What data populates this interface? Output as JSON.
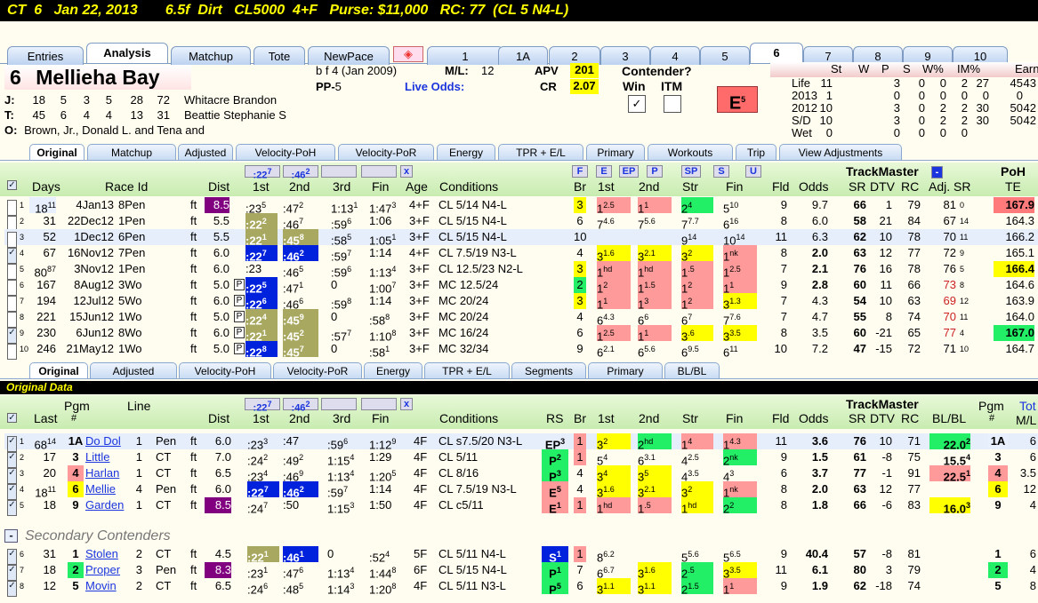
{
  "title": "CT  6   Jan 22, 2013       6.5f  Dirt   CL5000  4+F   Purse: $11,000   RC: 77  (CL 5 N4-L)",
  "main_tabs": [
    "Entries",
    "Analysis",
    "Matchup",
    "Tote",
    "NewPace"
  ],
  "horse_tabs": [
    "1",
    "1A",
    "2",
    "3",
    "4",
    "5",
    "6",
    "7",
    "8",
    "9",
    "10"
  ],
  "horse": {
    "num": "6",
    "name": "Mellieha Bay",
    "desc": "b f 4  (Jan 2009)",
    "pp_label": "PP-",
    "pp": "5",
    "ml_label": "M/L:",
    "ml": "12",
    "live_odds": "Live Odds:",
    "apv_label": "APV",
    "apv": "201",
    "cr_label": "CR",
    "cr": "2.07",
    "contender": "Contender?",
    "win": "Win",
    "itm": "ITM",
    "e_badge": "E",
    "e_sub": "5"
  },
  "jt": {
    "j_label": "J:",
    "j": [
      "18",
      "5",
      "3",
      "5",
      "28",
      "72"
    ],
    "j_name": "Whitacre Brandon",
    "t_label": "T:",
    "t": [
      "45",
      "6",
      "4",
      "4",
      "13",
      "31"
    ],
    "t_name": "Beattie Stephanie S",
    "o_label": "O:",
    "owner": "Brown, Jr., Donald L. and Tena and"
  },
  "stats": {
    "headers": [
      "St",
      "W",
      "P",
      "S",
      "W%",
      "IM%",
      "Earn"
    ],
    "rows": [
      [
        "Life",
        "11",
        "3",
        "0",
        "0",
        "2",
        "27",
        "45",
        "43"
      ],
      [
        "2013",
        "1",
        "0",
        "0",
        "0",
        "0",
        "0",
        "0",
        ""
      ],
      [
        "2012",
        "10",
        "3",
        "0",
        "2",
        "2",
        "30",
        "50",
        "42"
      ],
      [
        "S/D",
        "10",
        "3",
        "0",
        "2",
        "2",
        "30",
        "50",
        "42"
      ],
      [
        "Wet",
        "0",
        "0",
        "0",
        "0",
        "0",
        "",
        "",
        ""
      ]
    ]
  },
  "sub_tabs": [
    "Original",
    "Matchup",
    "Adjusted",
    "Velocity-PoH",
    "Velocity-PoR",
    "Energy",
    "TPR + E/L",
    "Primary",
    "Workouts",
    "Trip",
    "View Adjustments"
  ],
  "pp_headers": {
    "days": "Days",
    "raceid": "Race Id",
    "dist": "Dist",
    "c1": "1st",
    "c2": "2nd",
    "c3": "3rd",
    "fin": "Fin",
    "age": "Age",
    "cond": "Conditions",
    "br": "Br",
    "f1": "1st",
    "f2": "2nd",
    "str": "Str",
    "ffin": "Fin",
    "fld": "Fld",
    "odds": "Odds",
    "tm": "TrackMaster",
    "sr": "SR",
    "dtv": "DTV",
    "rc": "RC",
    "adj": "Adj. SR",
    "poh": "PoH",
    "te": "TE",
    "b1": ":22",
    "b1s": "7",
    "b2": ":46",
    "b2s": "2",
    "pbtns": [
      "F",
      "E",
      "EP",
      "P",
      "SP",
      "S",
      "U"
    ]
  },
  "pp_rows": [
    [
      "1",
      "18",
      "11",
      "4Jan13",
      "8Pen",
      "ft",
      "8.5",
      ":23",
      "5",
      ":47",
      "2",
      "1:13",
      "1",
      "1:47",
      "3",
      "4+F",
      "CL 5/14 N4-L",
      "3",
      "1",
      "2.5",
      "1",
      "1",
      "2",
      "4",
      "5",
      "10",
      "9",
      "9.7",
      "66",
      "1",
      "79",
      "81",
      "0",
      "167.9"
    ],
    [
      "2",
      "31",
      "",
      "22Dec12",
      "1Pen",
      "ft",
      "5.5",
      ":22",
      "2",
      ":46",
      "7",
      ":59",
      "6",
      "1:06",
      "",
      "3+F",
      "CL 5/15 N4-L",
      "6",
      "7",
      "4.6",
      "7",
      "5.6",
      "7",
      "7.7",
      "6",
      "16",
      "8",
      "6.0",
      "58",
      "21",
      "84",
      "67",
      "14",
      "164.3"
    ],
    [
      "3",
      "52",
      "",
      "1Dec12",
      "6Pen",
      "ft",
      "5.5",
      ":22",
      "1",
      ":45",
      "8",
      ":58",
      "5",
      "1:05",
      "1",
      "3+F",
      "CL 5/15 N4-L",
      "10",
      "",
      "",
      "",
      "",
      "9",
      "14",
      "10",
      "14",
      "11",
      "6.3",
      "62",
      "10",
      "78",
      "70",
      "11",
      "166.2"
    ],
    [
      "4",
      "67",
      "",
      "16Nov12",
      "7Pen",
      "ft",
      "6.0",
      ":22",
      "7",
      ":46",
      "2",
      ":59",
      "7",
      "1:14",
      "",
      "4+F",
      "CL 7.5/19 N3-L",
      "4",
      "3",
      "1.6",
      "3",
      "2.1",
      "3",
      "2",
      "1",
      "nk",
      "8",
      "2.0",
      "63",
      "12",
      "77",
      "72",
      "9",
      "165.1"
    ],
    [
      "5",
      "80",
      "87",
      "3Nov12",
      "1Pen",
      "ft",
      "6.0",
      ":23",
      "",
      ":46",
      "5",
      ":59",
      "6",
      "1:13",
      "4",
      "3+F",
      "CL 12.5/23 N2-L",
      "3",
      "1",
      "hd",
      "1",
      "hd",
      "1",
      ".5",
      "1",
      "2.5",
      "7",
      "2.1",
      "76",
      "16",
      "78",
      "76",
      "5",
      "166.4"
    ],
    [
      "6",
      "167",
      "",
      "8Aug12",
      "3Wo",
      "ft",
      "5.0",
      ":22",
      "5",
      ":47",
      "1",
      "0",
      "",
      "1:00",
      "7",
      "3+F",
      "MC 12.5/24",
      "2",
      "1",
      "2",
      "1",
      "1.5",
      "1",
      "2",
      "1",
      "1",
      "9",
      "2.8",
      "60",
      "11",
      "66",
      "73",
      "8",
      "164.6"
    ],
    [
      "7",
      "194",
      "",
      "12Jul12",
      "5Wo",
      "ft",
      "6.0",
      ":22",
      "6",
      ":46",
      "6",
      ":59",
      "8",
      "1:14",
      "",
      "3+F",
      "MC 20/24",
      "3",
      "1",
      "1",
      "1",
      "3",
      "1",
      "2",
      "3",
      "1.3",
      "7",
      "4.3",
      "54",
      "10",
      "63",
      "69",
      "12",
      "163.9"
    ],
    [
      "8",
      "221",
      "",
      "15Jun12",
      "1Wo",
      "ft",
      "5.0",
      ":22",
      "4",
      ":45",
      "9",
      "0",
      "",
      ":58",
      "8",
      "3+F",
      "MC 20/24",
      "4",
      "6",
      "4.3",
      "6",
      "6",
      "6",
      "7",
      "7",
      "7.6",
      "7",
      "4.7",
      "55",
      "8",
      "74",
      "70",
      "11",
      "164.0"
    ],
    [
      "9",
      "230",
      "",
      "6Jun12",
      "8Wo",
      "ft",
      "6.0",
      ":22",
      "1",
      ":45",
      "2",
      ":57",
      "7",
      "1:10",
      "8",
      "3+F",
      "MC 16/24",
      "6",
      "1",
      "2.5",
      "1",
      "1",
      "3",
      ".6",
      "3",
      "3.5",
      "8",
      "3.5",
      "60",
      "-21",
      "65",
      "77",
      "4",
      "167.0"
    ],
    [
      "10",
      "246",
      "",
      "21May12",
      "1Wo",
      "ft",
      "5.0",
      ":22",
      "8",
      ":45",
      "7",
      "0",
      "",
      ":58",
      "1",
      "3+F",
      "MC 32/34",
      "9",
      "6",
      "2.1",
      "6",
      "5.6",
      "6",
      "9.5",
      "6",
      "11",
      "10",
      "7.2",
      "47",
      "-15",
      "72",
      "71",
      "10",
      "164.7"
    ]
  ],
  "sub_tabs2": [
    "Original",
    "Adjusted",
    "Velocity-PoH",
    "Velocity-PoR",
    "Energy",
    "TPR + E/L",
    "Segments",
    "Primary",
    "BL/BL"
  ],
  "section": "Original Data",
  "od_headers": {
    "last": "Last",
    "pgm": "Pgm",
    "pgm2": "#",
    "line": "Line",
    "dist": "Dist",
    "c1": "1st",
    "c2": "2nd",
    "c3": "3rd",
    "fin": "Fin",
    "cond": "Conditions",
    "rs": "RS",
    "br": "Br",
    "f1": "1st",
    "f2": "2nd",
    "str": "Str",
    "ffin": "Fin",
    "fld": "Fld",
    "odds": "Odds",
    "tm": "TrackMaster",
    "sr": "SR",
    "dtv": "DTV",
    "rc": "RC",
    "blbl": "BL/BL",
    "pgmr": "Pgm",
    "pgmr2": "#",
    "tot": "Tot",
    "ml": "M/L",
    "b1": ":22",
    "b1s": "7",
    "b2": ":46",
    "b2s": "2"
  },
  "od_rows": [
    [
      "1",
      "68",
      "14",
      "1A",
      "Do Dol",
      "1",
      "Pen",
      "ft",
      "6.0",
      ":23",
      "3",
      ":47",
      "",
      ":59",
      "6",
      "1:12",
      "9",
      "4F",
      "CL s7.5/20 N3-L",
      "EP",
      "3",
      "1",
      "3",
      "2",
      "2",
      "hd",
      "1",
      "4",
      "1",
      "4.3",
      "11",
      "3.6",
      "76",
      "10",
      "71",
      "22.0",
      "2",
      "1A",
      "6"
    ],
    [
      "2",
      "17",
      "",
      "3",
      "Little",
      "1",
      "CT",
      "ft",
      "7.0",
      ":24",
      "2",
      ":49",
      "2",
      "1:15",
      "4",
      "1:29",
      "",
      "4F",
      "CL 5/11",
      "P",
      "2",
      "1",
      "5",
      "4",
      "6",
      "3.1",
      "4",
      "2.5",
      "2",
      "nk",
      "9",
      "1.5",
      "61",
      "-8",
      "75",
      "15.5",
      "4",
      "3",
      "6"
    ],
    [
      "3",
      "20",
      "",
      "4",
      "Harlan",
      "1",
      "CT",
      "ft",
      "6.5",
      ":23",
      "4",
      ":46",
      "9",
      "1:13",
      "4",
      "1:20",
      "5",
      "4F",
      "CL 8/16",
      "P",
      "3",
      "4",
      "3",
      "4",
      "3",
      "5",
      "4",
      "3.5",
      "4",
      "3",
      "6",
      "3.7",
      "77",
      "-1",
      "91",
      "22.5",
      "1",
      "4",
      "3.5"
    ],
    [
      "4",
      "18",
      "11",
      "6",
      "Mellie",
      "4",
      "Pen",
      "ft",
      "6.0",
      ":22",
      "7",
      ":46",
      "2",
      ":59",
      "7",
      "1:14",
      "",
      "4F",
      "CL 7.5/19 N3-L",
      "E",
      "5",
      "4",
      "3",
      "1.6",
      "3",
      "2.1",
      "3",
      "2",
      "1",
      "nk",
      "8",
      "2.0",
      "63",
      "12",
      "77",
      "",
      "",
      "6",
      "12"
    ],
    [
      "5",
      "18",
      "",
      "9",
      "Garden",
      "1",
      "CT",
      "ft",
      "8.5",
      ":24",
      "7",
      ":50",
      "",
      "1:15",
      "3",
      "1:50",
      "",
      "4F",
      "CL c5/11",
      "E",
      "1",
      "1",
      "1",
      "hd",
      "1",
      ".5",
      "1",
      "hd",
      "2",
      "2",
      "8",
      "1.8",
      "66",
      "-6",
      "83",
      "16.0",
      "3",
      "9",
      "4"
    ]
  ],
  "secondary": "Secondary Contenders",
  "sec_rows": [
    [
      "6",
      "31",
      "",
      "1",
      "Stolen",
      "2",
      "CT",
      "ft",
      "4.5",
      ":22",
      "1",
      ":46",
      "1",
      "0",
      "",
      ":52",
      "4",
      "5F",
      "CL 5/11 N4-L",
      "S",
      "1",
      "1",
      "8",
      "6.2",
      "",
      "",
      "5",
      "5.6",
      "5",
      "6.5",
      "9",
      "40.4",
      "57",
      "-8",
      "81",
      "",
      "",
      "1",
      "6"
    ],
    [
      "7",
      "18",
      "",
      "2",
      "Proper",
      "3",
      "Pen",
      "ft",
      "8.3",
      ":23",
      "1",
      ":47",
      "6",
      "1:13",
      "4",
      "1:44",
      "8",
      "6F",
      "CL 5/15 N4-L",
      "P",
      "1",
      "7",
      "6",
      "6.7",
      "3",
      "1.6",
      "2",
      ".5",
      "3",
      "3.5",
      "11",
      "6.1",
      "80",
      "3",
      "79",
      "",
      "",
      "2",
      "4"
    ],
    [
      "8",
      "12",
      "",
      "5",
      "Movin",
      "2",
      "CT",
      "ft",
      "6.5",
      ":24",
      "6",
      ":48",
      "5",
      "1:14",
      "3",
      "1:20",
      "8",
      "4F",
      "CL 5/11 N3-L",
      "P",
      "5",
      "6",
      "3",
      "1.1",
      "3",
      "1.1",
      "2",
      "1.5",
      "1",
      "1",
      "9",
      "1.9",
      "62",
      "-18",
      "74",
      "",
      "",
      "5",
      "8"
    ]
  ]
}
